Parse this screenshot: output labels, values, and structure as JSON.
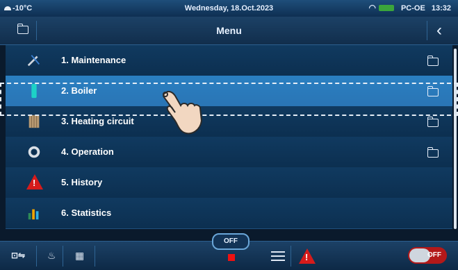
{
  "status": {
    "temperature": "-10°C",
    "date": "Wednesday, 18.Oct.2023",
    "device": "PC-OE",
    "time": "13:32"
  },
  "header": {
    "title": "Menu"
  },
  "menu": {
    "items": [
      {
        "label": "1. Maintenance",
        "icon": "tools-icon",
        "has_folder": true
      },
      {
        "label": "2. Boiler",
        "icon": "boiler-icon",
        "has_folder": true,
        "selected": true
      },
      {
        "label": "3. Heating circuit",
        "icon": "radiator-icon",
        "has_folder": true
      },
      {
        "label": "4. Operation",
        "icon": "gear-icon",
        "has_folder": true
      },
      {
        "label": "5. History",
        "icon": "warning-icon",
        "has_folder": false
      },
      {
        "label": "6. Statistics",
        "icon": "bar-chart-icon",
        "has_folder": false
      }
    ]
  },
  "footer": {
    "off_label": "OFF",
    "toggle_label": "OFF"
  },
  "colors": {
    "accent": "#2a7fc1",
    "alert": "#d61b1b",
    "background": "#0c2f50"
  }
}
